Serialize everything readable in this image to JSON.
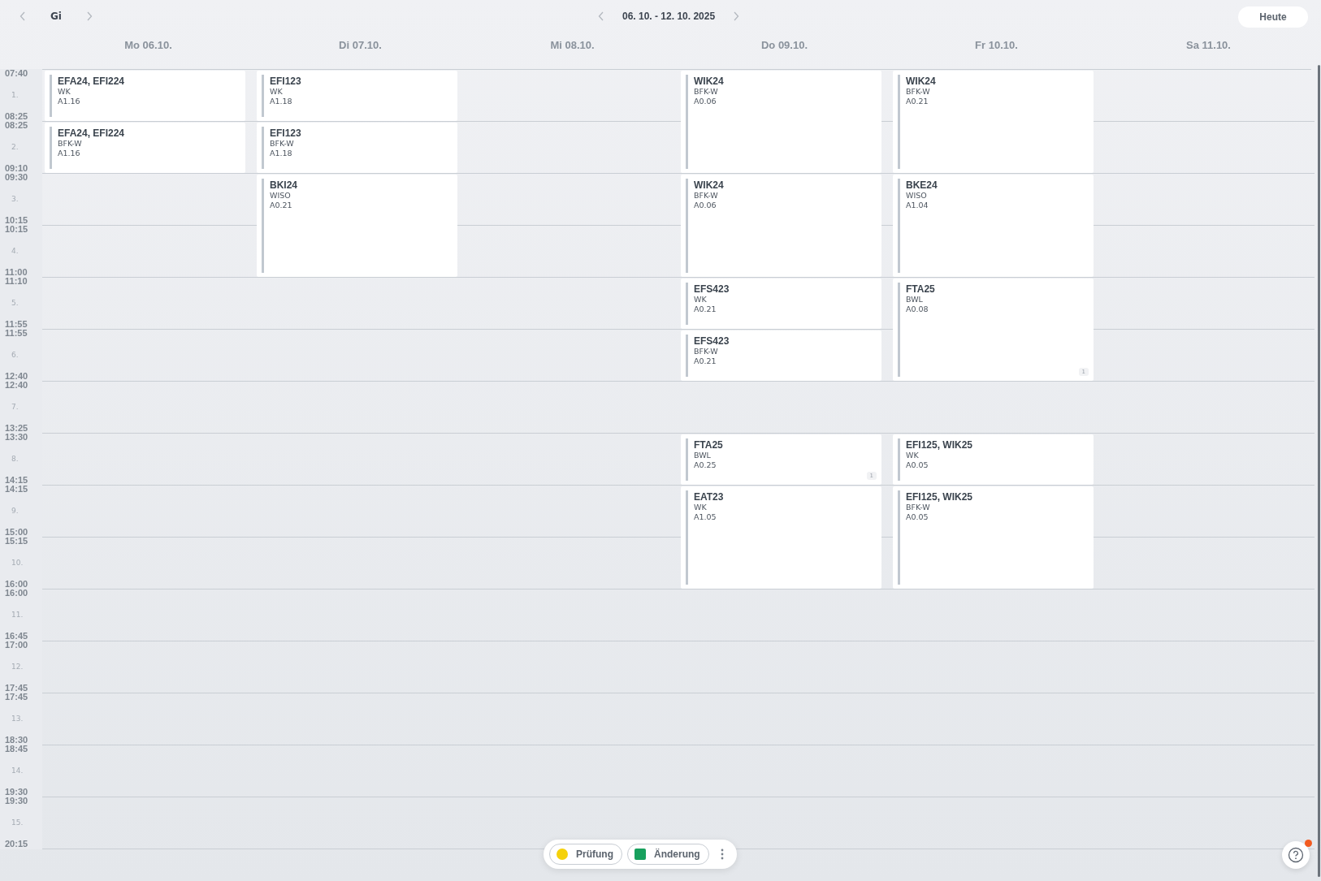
{
  "toolbar": {
    "class_label": "Gi",
    "week_range": "06. 10. - 12. 10. 2025",
    "today_button": "Heute"
  },
  "days": [
    {
      "label": "Mo 06.10.",
      "slots": [
        {
          "kind": "lesson",
          "double": false,
          "classes": "EFA24, EFI224",
          "subject": "WK",
          "room": "A1.16"
        },
        {
          "kind": "lesson",
          "double": false,
          "classes": "EFA24, EFI224",
          "subject": "BFK-W",
          "room": "A1.16"
        }
      ]
    },
    {
      "label": "Di 07.10.",
      "slots": [
        {
          "kind": "lesson",
          "double": false,
          "classes": "EFI123",
          "subject": "WK",
          "room": "A1.18"
        },
        {
          "kind": "lesson",
          "double": false,
          "classes": "EFI123",
          "subject": "BFK-W",
          "room": "A1.18"
        },
        {
          "kind": "lesson",
          "double": true,
          "classes": "BKI24",
          "subject": "WISO",
          "room": "A0.21"
        }
      ]
    },
    {
      "label": "Mi 08.10."
    },
    {
      "label": "Do 09.10.",
      "slots": [
        {
          "kind": "lesson",
          "double": true,
          "classes": "WIK24",
          "subject": "BFK-W",
          "room": "A0.06"
        },
        {
          "kind": "lesson",
          "double": true,
          "classes": "WIK24",
          "subject": "BFK-W",
          "room": "A0.06"
        },
        {
          "kind": "lesson",
          "double": false,
          "classes": "EFS423",
          "subject": "WK",
          "room": "A0.21"
        },
        {
          "kind": "lesson",
          "double": false,
          "classes": "EFS423",
          "subject": "BFK-W",
          "room": "A0.21"
        },
        {
          "kind": "free"
        },
        {
          "kind": "lesson",
          "double": false,
          "classes": "FTA25",
          "subject": "BWL",
          "room": "A0.25",
          "badge": "1"
        },
        {
          "kind": "lesson",
          "double": true,
          "classes": "EAT23",
          "subject": "WK",
          "room": "A1.05"
        }
      ]
    },
    {
      "label": "Fr 10.10.",
      "slots": [
        {
          "kind": "lesson",
          "double": true,
          "classes": "WIK24",
          "subject": "BFK-W",
          "room": "A0.21"
        },
        {
          "kind": "lesson",
          "double": true,
          "classes": "BKE24",
          "subject": "WISO",
          "room": "A1.04"
        },
        {
          "kind": "lesson",
          "double": true,
          "classes": "FTA25",
          "subject": "BWL",
          "room": "A0.08",
          "badge": "1"
        },
        {
          "kind": "free"
        },
        {
          "kind": "lesson",
          "double": false,
          "classes": "EFI125, WIK25",
          "subject": "WK",
          "room": "A0.05"
        },
        {
          "kind": "lesson",
          "double": true,
          "classes": "EFI125, WIK25",
          "subject": "BFK-W",
          "room": "A0.05"
        }
      ]
    },
    {
      "label": "Sa 11.10."
    }
  ],
  "periods": [
    {
      "start": "07:40",
      "number": "1.",
      "end": "08:25"
    },
    {
      "start": "08:25",
      "number": "2.",
      "end": "09:10"
    },
    {
      "start": "09:30",
      "number": "3.",
      "end": "10:15"
    },
    {
      "start": "10:15",
      "number": "4.",
      "end": "11:00"
    },
    {
      "start": "11:10",
      "number": "5.",
      "end": "11:55"
    },
    {
      "start": "11:55",
      "number": "6.",
      "end": "12:40"
    },
    {
      "start": "12:40",
      "number": "7.",
      "end": "13:25"
    },
    {
      "start": "13:30",
      "number": "8.",
      "end": "14:15"
    },
    {
      "start": "14:15",
      "number": "9.",
      "end": "15:00"
    },
    {
      "start": "15:15",
      "number": "10.",
      "end": "16:00"
    },
    {
      "start": "16:00",
      "number": "11.",
      "end": "16:45"
    },
    {
      "start": "17:00",
      "number": "12.",
      "end": "17:45"
    },
    {
      "start": "17:45",
      "number": "13.",
      "end": "18:30"
    },
    {
      "start": "18:45",
      "number": "14.",
      "end": "19:30"
    },
    {
      "start": "19:30",
      "number": "15.",
      "end": "20:15"
    }
  ],
  "legend": [
    {
      "kind": "dot",
      "label": "Prüfung",
      "color": "#f5d10a"
    },
    {
      "kind": "square",
      "label": "Änderung",
      "color": "#17a05d"
    }
  ],
  "help": {
    "notification": true
  }
}
